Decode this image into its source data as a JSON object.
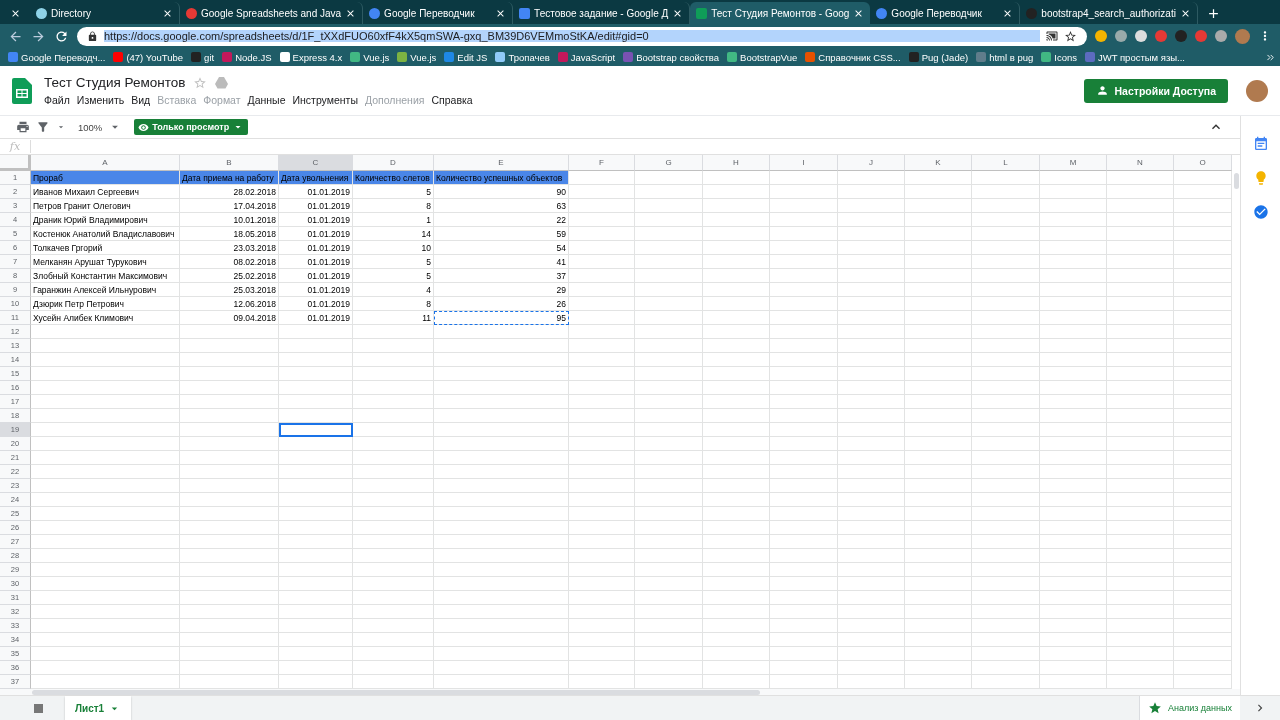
{
  "browser": {
    "tabs": [
      {
        "title": "Directory",
        "selected": false
      },
      {
        "title": "Google Spreadsheets and Java",
        "selected": false
      },
      {
        "title": "Google Переводчик",
        "selected": false
      },
      {
        "title": "Тестовое задание - Google Д",
        "selected": false
      },
      {
        "title": "Тест Студия Ремонтов - Goog",
        "selected": true
      },
      {
        "title": "Google Переводчик",
        "selected": false
      },
      {
        "title": "bootstrap4_search_authorizati",
        "selected": false
      }
    ],
    "address_bar": {
      "url": "https://docs.google.com/spreadsheets/d/1F_tXXdFUO60xfF4kX5qmSWA-gxq_BM39D6VEMmoStKA/edit#gid=0",
      "selected": true
    },
    "bookmarks": [
      "Google Переводч...",
      "(47) YouTube",
      "git",
      "Node.JS",
      "Express 4.x",
      "Vue.js",
      "Vue.js",
      "Edit JS",
      "Тропачев",
      "JavaScript",
      "Bootstrap свойства",
      "BootstrapVue",
      "Справочник CSS...",
      "Pug (Jade)",
      "html в pug",
      "Icons",
      "JWT простым язы..."
    ]
  },
  "document": {
    "title": "Тест Студия Ремонтов",
    "menu": [
      {
        "label": "Файл",
        "disabled": false
      },
      {
        "label": "Изменить",
        "disabled": false
      },
      {
        "label": "Вид",
        "disabled": false
      },
      {
        "label": "Вставка",
        "disabled": true
      },
      {
        "label": "Формат",
        "disabled": true
      },
      {
        "label": "Данные",
        "disabled": false
      },
      {
        "label": "Инструменты",
        "disabled": false
      },
      {
        "label": "Дополнения",
        "disabled": true
      },
      {
        "label": "Справка",
        "disabled": false
      }
    ],
    "share_button": "Настройки Доступа",
    "toolbar": {
      "zoom": "100%",
      "mode_button": "Только просмотр"
    },
    "formula_bar": {
      "label": "fx"
    }
  },
  "grid": {
    "columns": [
      {
        "label": "A",
        "selected": false
      },
      {
        "label": "B",
        "selected": false
      },
      {
        "label": "C",
        "selected": true
      },
      {
        "label": "D",
        "selected": false
      },
      {
        "label": "E",
        "selected": false
      },
      {
        "label": "F",
        "selected": false
      },
      {
        "label": "G",
        "selected": false
      },
      {
        "label": "H",
        "selected": false
      },
      {
        "label": "I",
        "selected": false
      },
      {
        "label": "J",
        "selected": false
      },
      {
        "label": "K",
        "selected": false
      },
      {
        "label": "L",
        "selected": false
      },
      {
        "label": "M",
        "selected": false
      },
      {
        "label": "N",
        "selected": false
      },
      {
        "label": "O",
        "selected": false
      }
    ],
    "row_numbers": [
      {
        "label": "1",
        "selected": false
      },
      {
        "label": "2",
        "selected": false
      },
      {
        "label": "3",
        "selected": false
      },
      {
        "label": "4",
        "selected": false
      },
      {
        "label": "5",
        "selected": false
      },
      {
        "label": "6",
        "selected": false
      },
      {
        "label": "7",
        "selected": false
      },
      {
        "label": "8",
        "selected": false
      },
      {
        "label": "9",
        "selected": false
      },
      {
        "label": "10",
        "selected": false
      },
      {
        "label": "11",
        "selected": false
      },
      {
        "label": "12",
        "selected": false
      },
      {
        "label": "13",
        "selected": false
      },
      {
        "label": "14",
        "selected": false
      },
      {
        "label": "15",
        "selected": false
      },
      {
        "label": "16",
        "selected": false
      },
      {
        "label": "17",
        "selected": false
      },
      {
        "label": "18",
        "selected": false
      },
      {
        "label": "19",
        "selected": true
      },
      {
        "label": "20",
        "selected": false
      },
      {
        "label": "21",
        "selected": false
      },
      {
        "label": "22",
        "selected": false
      },
      {
        "label": "23",
        "selected": false
      },
      {
        "label": "24",
        "selected": false
      },
      {
        "label": "25",
        "selected": false
      },
      {
        "label": "26",
        "selected": false
      },
      {
        "label": "27",
        "selected": false
      },
      {
        "label": "28",
        "selected": false
      },
      {
        "label": "29",
        "selected": false
      },
      {
        "label": "30",
        "selected": false
      },
      {
        "label": "31",
        "selected": false
      },
      {
        "label": "32",
        "selected": false
      },
      {
        "label": "33",
        "selected": false
      },
      {
        "label": "34",
        "selected": false
      },
      {
        "label": "35",
        "selected": false
      },
      {
        "label": "36",
        "selected": false
      },
      {
        "label": "37",
        "selected": false
      }
    ],
    "rows": [
      {
        "kind": "header",
        "cells": [
          {
            "text": "Прораб",
            "copied": false
          },
          {
            "text": "Дата приема на работу",
            "copied": false
          },
          {
            "text": "Дата увольнения",
            "copied": false
          },
          {
            "text": "Количество слетов",
            "copied": false
          },
          {
            "text": "Количество успешных объектов",
            "copied": false
          }
        ]
      },
      {
        "kind": "data",
        "cells": [
          {
            "text": "Иванов Михаил Сергеевич",
            "copied": false
          },
          {
            "text": "28.02.2018",
            "copied": false
          },
          {
            "text": "01.01.2019",
            "copied": false
          },
          {
            "text": "5",
            "copied": false
          },
          {
            "text": "90",
            "copied": false
          }
        ]
      },
      {
        "kind": "data",
        "cells": [
          {
            "text": "Петров Гранит Олегович",
            "copied": false
          },
          {
            "text": "17.04.2018",
            "copied": false
          },
          {
            "text": "01.01.2019",
            "copied": false
          },
          {
            "text": "8",
            "copied": false
          },
          {
            "text": "63",
            "copied": false
          }
        ]
      },
      {
        "kind": "data",
        "cells": [
          {
            "text": "Драник Юрий Владимирович",
            "copied": false
          },
          {
            "text": "10.01.2018",
            "copied": false
          },
          {
            "text": "01.01.2019",
            "copied": false
          },
          {
            "text": "1",
            "copied": false
          },
          {
            "text": "22",
            "copied": false
          }
        ]
      },
      {
        "kind": "data",
        "cells": [
          {
            "text": "Костенюк Анатолий Владиславович",
            "copied": false
          },
          {
            "text": "18.05.2018",
            "copied": false
          },
          {
            "text": "01.01.2019",
            "copied": false
          },
          {
            "text": "14",
            "copied": false
          },
          {
            "text": "59",
            "copied": false
          }
        ]
      },
      {
        "kind": "data",
        "cells": [
          {
            "text": "Толкачев Гргорий",
            "copied": false
          },
          {
            "text": "23.03.2018",
            "copied": false
          },
          {
            "text": "01.01.2019",
            "copied": false
          },
          {
            "text": "10",
            "copied": false
          },
          {
            "text": "54",
            "copied": false
          }
        ]
      },
      {
        "kind": "data",
        "cells": [
          {
            "text": "Мелканян Арушат Турукович",
            "copied": false
          },
          {
            "text": "08.02.2018",
            "copied": false
          },
          {
            "text": "01.01.2019",
            "copied": false
          },
          {
            "text": "5",
            "copied": false
          },
          {
            "text": "41",
            "copied": false
          }
        ]
      },
      {
        "kind": "data",
        "cells": [
          {
            "text": "Злобный Константин Максимович",
            "copied": false
          },
          {
            "text": "25.02.2018",
            "copied": false
          },
          {
            "text": "01.01.2019",
            "copied": false
          },
          {
            "text": "5",
            "copied": false
          },
          {
            "text": "37",
            "copied": false
          }
        ]
      },
      {
        "kind": "data",
        "cells": [
          {
            "text": "Гаранжин Алексей Ильнурович",
            "copied": false
          },
          {
            "text": "25.03.2018",
            "copied": false
          },
          {
            "text": "01.01.2019",
            "copied": false
          },
          {
            "text": "4",
            "copied": false
          },
          {
            "text": "29",
            "copied": false
          }
        ]
      },
      {
        "kind": "data",
        "cells": [
          {
            "text": "Дзюрик Петр Петрович",
            "copied": false
          },
          {
            "text": "12.06.2018",
            "copied": false
          },
          {
            "text": "01.01.2019",
            "copied": false
          },
          {
            "text": "8",
            "copied": false
          },
          {
            "text": "26",
            "copied": false
          }
        ]
      },
      {
        "kind": "data",
        "cells": [
          {
            "text": "Хусейн Алибек Климович",
            "copied": false
          },
          {
            "text": "09.04.2018",
            "copied": false
          },
          {
            "text": "01.01.2019",
            "copied": false
          },
          {
            "text": "11",
            "copied": false
          },
          {
            "text": "95",
            "copied": true
          }
        ]
      }
    ]
  },
  "sheet_bar": {
    "tabs": [
      {
        "label": "Лист1",
        "selected": true
      }
    ],
    "explore_button": "Анализ данных"
  }
}
